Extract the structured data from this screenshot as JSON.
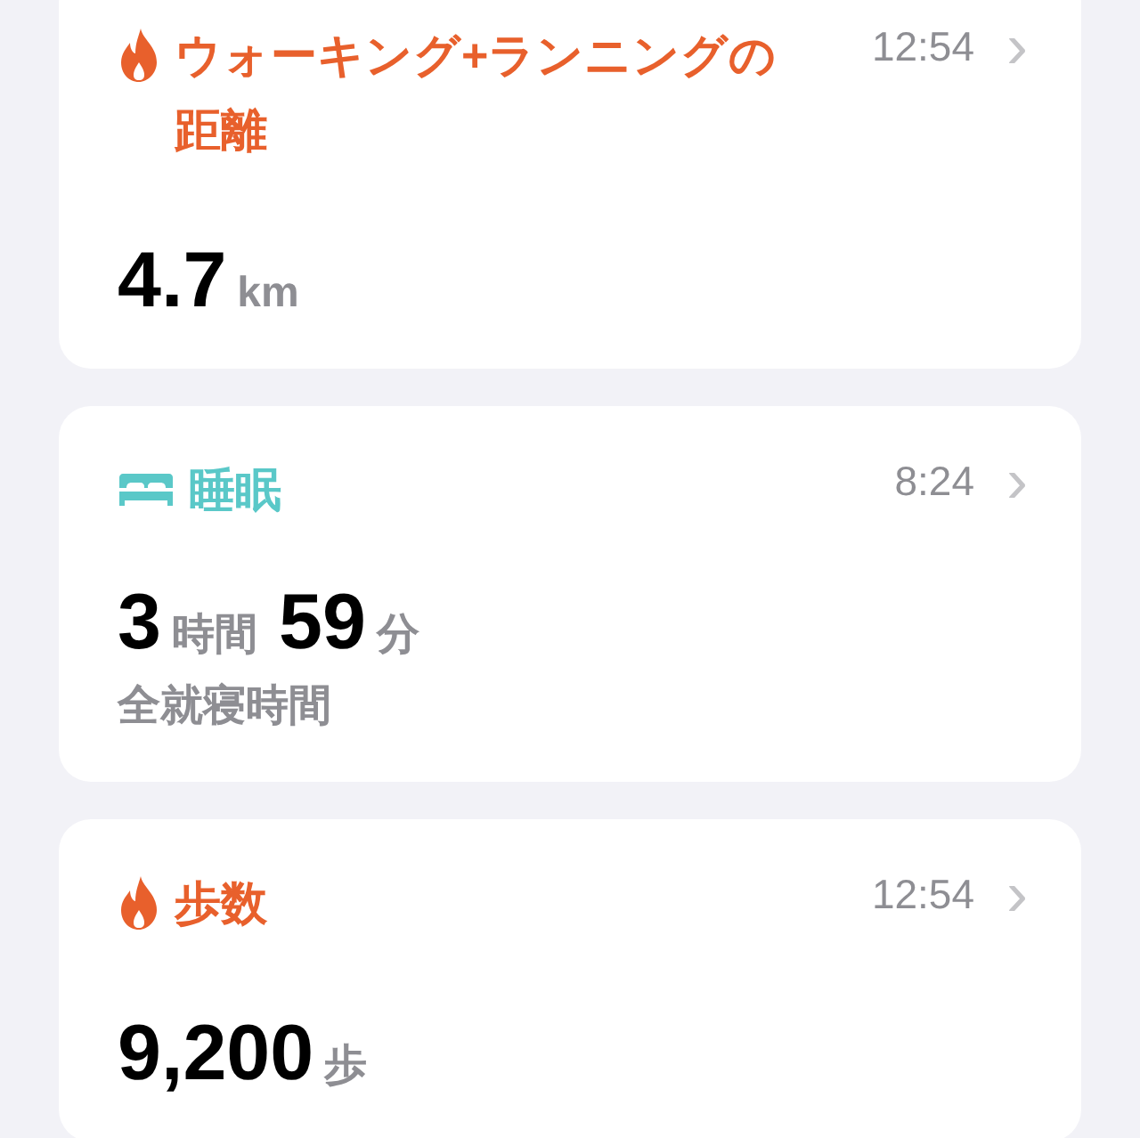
{
  "cards": [
    {
      "kind": "flame",
      "color": "#e8602c",
      "title": "ウォーキング+ランニングの距離",
      "time": "12:54",
      "chevron": "›",
      "values": [
        {
          "number": "4.7",
          "unit": "km"
        }
      ]
    },
    {
      "kind": "bed",
      "color": "#5ac8c8",
      "title": "睡眠",
      "time": "8:24",
      "chevron": "›",
      "values": [
        {
          "number": "3",
          "unit": "時間"
        },
        {
          "number": "59",
          "unit": "分"
        }
      ],
      "caption": "全就寝時間"
    },
    {
      "kind": "flame",
      "color": "#e8602c",
      "title": "歩数",
      "time": "12:54",
      "chevron": "›",
      "values": [
        {
          "number": "9,200",
          "unit": "歩"
        }
      ]
    }
  ]
}
